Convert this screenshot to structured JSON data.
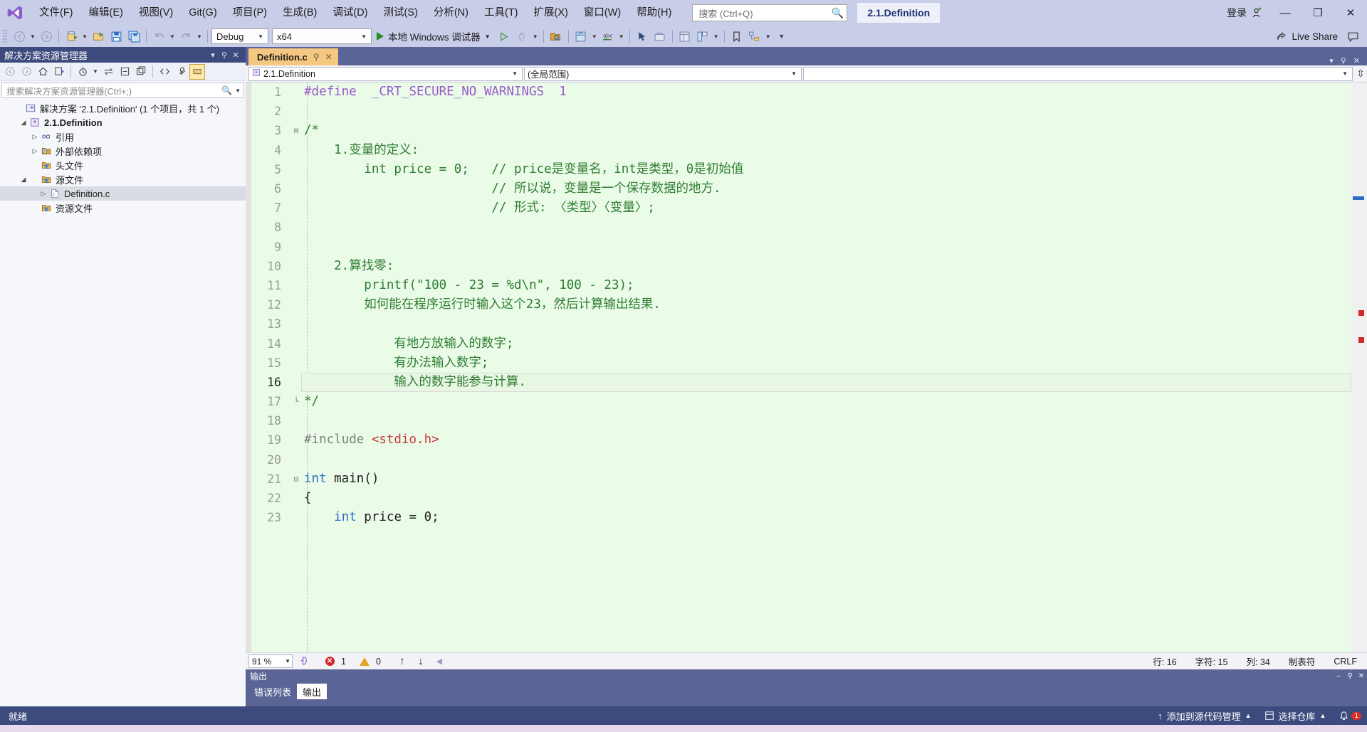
{
  "window": {
    "doc_tab_title": "2.1.Definition",
    "signin_label": "登录",
    "minimize": "—",
    "maximize": "❐",
    "close": "✕"
  },
  "menu": {
    "items": [
      {
        "label": "文件(F)"
      },
      {
        "label": "编辑(E)"
      },
      {
        "label": "视图(V)"
      },
      {
        "label": "Git(G)"
      },
      {
        "label": "项目(P)"
      },
      {
        "label": "生成(B)"
      },
      {
        "label": "调试(D)"
      },
      {
        "label": "测试(S)"
      },
      {
        "label": "分析(N)"
      },
      {
        "label": "工具(T)"
      },
      {
        "label": "扩展(X)"
      },
      {
        "label": "窗口(W)"
      },
      {
        "label": "帮助(H)"
      }
    ],
    "search_placeholder": "搜索 (Ctrl+Q)"
  },
  "toolbar": {
    "config_value": "Debug",
    "platform_value": "x64",
    "run_label": "本地 Windows 调试器",
    "live_share_label": "Live Share"
  },
  "solution_explorer": {
    "title": "解决方案资源管理器",
    "search_placeholder": "搜索解决方案资源管理器(Ctrl+;)",
    "tree": [
      {
        "label": "解决方案 '2.1.Definition' (1 个项目，共 1 个)",
        "indent": 0,
        "arrow": "none",
        "icon": "solution-icon",
        "bold": false,
        "selected": false
      },
      {
        "label": "2.1.Definition",
        "indent": 1,
        "arrow": "open",
        "icon": "project-icon",
        "bold": true,
        "selected": false
      },
      {
        "label": "引用",
        "indent": 2,
        "arrow": "closed",
        "icon": "references-icon",
        "bold": false,
        "selected": false
      },
      {
        "label": "外部依赖项",
        "indent": 2,
        "arrow": "closed",
        "icon": "folder-ext-icon",
        "bold": false,
        "selected": false
      },
      {
        "label": "头文件",
        "indent": 2,
        "arrow": "none",
        "icon": "folder-filter-icon",
        "bold": false,
        "selected": false
      },
      {
        "label": "源文件",
        "indent": 2,
        "arrow": "open",
        "icon": "folder-filter-icon",
        "bold": false,
        "selected": false
      },
      {
        "label": "Definition.c",
        "indent": 3,
        "arrow": "closed",
        "icon": "c-file-icon",
        "bold": false,
        "selected": true
      },
      {
        "label": "资源文件",
        "indent": 2,
        "arrow": "none",
        "icon": "folder-filter-icon",
        "bold": false,
        "selected": false
      }
    ]
  },
  "editor": {
    "tab_label": "Definition.c",
    "nav_project": "2.1.Definition",
    "nav_scope": "(全局范围)",
    "nav_member": "",
    "zoom": "91 %",
    "error_count": "1",
    "warning_count": "0",
    "status_line": "行: 16",
    "status_char": "字符: 15",
    "status_col": "列: 34",
    "status_tab": "制表符",
    "status_eol": "CRLF",
    "lines": [
      {
        "n": "1",
        "fold": "",
        "text": "#define  _CRT_SECURE_NO_WARNINGS  1",
        "kind": "define"
      },
      {
        "n": "2",
        "fold": "",
        "text": "",
        "kind": "plain"
      },
      {
        "n": "3",
        "fold": "minus",
        "text": "/*",
        "kind": "comment"
      },
      {
        "n": "4",
        "fold": "",
        "text": "    1.变量的定义:",
        "kind": "comment"
      },
      {
        "n": "5",
        "fold": "",
        "text": "        int price = 0;   // price是变量名，int是类型，0是初始值",
        "kind": "comment"
      },
      {
        "n": "6",
        "fold": "",
        "text": "                         // 所以说，变量是一个保存数据的地方.",
        "kind": "comment"
      },
      {
        "n": "7",
        "fold": "",
        "text": "                         // 形式: 〈类型〉〈变量〉;",
        "kind": "comment"
      },
      {
        "n": "8",
        "fold": "",
        "text": "",
        "kind": "comment"
      },
      {
        "n": "9",
        "fold": "",
        "text": "",
        "kind": "comment"
      },
      {
        "n": "10",
        "fold": "",
        "text": "    2.算找零:",
        "kind": "comment"
      },
      {
        "n": "11",
        "fold": "",
        "text": "        printf(\"100 - 23 = %d\\n\", 100 - 23);",
        "kind": "comment"
      },
      {
        "n": "12",
        "fold": "",
        "text": "        如何能在程序运行时输入这个23，然后计算输出结果.",
        "kind": "comment"
      },
      {
        "n": "13",
        "fold": "",
        "text": "",
        "kind": "comment"
      },
      {
        "n": "14",
        "fold": "",
        "text": "            有地方放输入的数字;",
        "kind": "comment"
      },
      {
        "n": "15",
        "fold": "",
        "text": "            有办法输入数字;",
        "kind": "comment"
      },
      {
        "n": "16",
        "fold": "",
        "text": "            输入的数字能参与计算.",
        "kind": "comment",
        "current": true
      },
      {
        "n": "17",
        "fold": "end",
        "text": "*/",
        "kind": "comment"
      },
      {
        "n": "18",
        "fold": "",
        "text": "",
        "kind": "plain"
      },
      {
        "n": "19",
        "fold": "",
        "text": "#include <stdio.h>",
        "kind": "include"
      },
      {
        "n": "20",
        "fold": "",
        "text": "",
        "kind": "plain"
      },
      {
        "n": "21",
        "fold": "minus",
        "text": "int main()",
        "kind": "func"
      },
      {
        "n": "22",
        "fold": "",
        "text": "{",
        "kind": "plain"
      },
      {
        "n": "23",
        "fold": "",
        "text": "    int price = 0;",
        "kind": "decl"
      }
    ]
  },
  "bottom_panel": {
    "title": "输出",
    "tabs": [
      {
        "label": "错误列表",
        "active": false
      },
      {
        "label": "输出",
        "active": true
      }
    ]
  },
  "statusbar": {
    "ready": "就绪",
    "source_control": "添加到源代码管理",
    "repo": "选择仓库",
    "notification_count": "1"
  }
}
